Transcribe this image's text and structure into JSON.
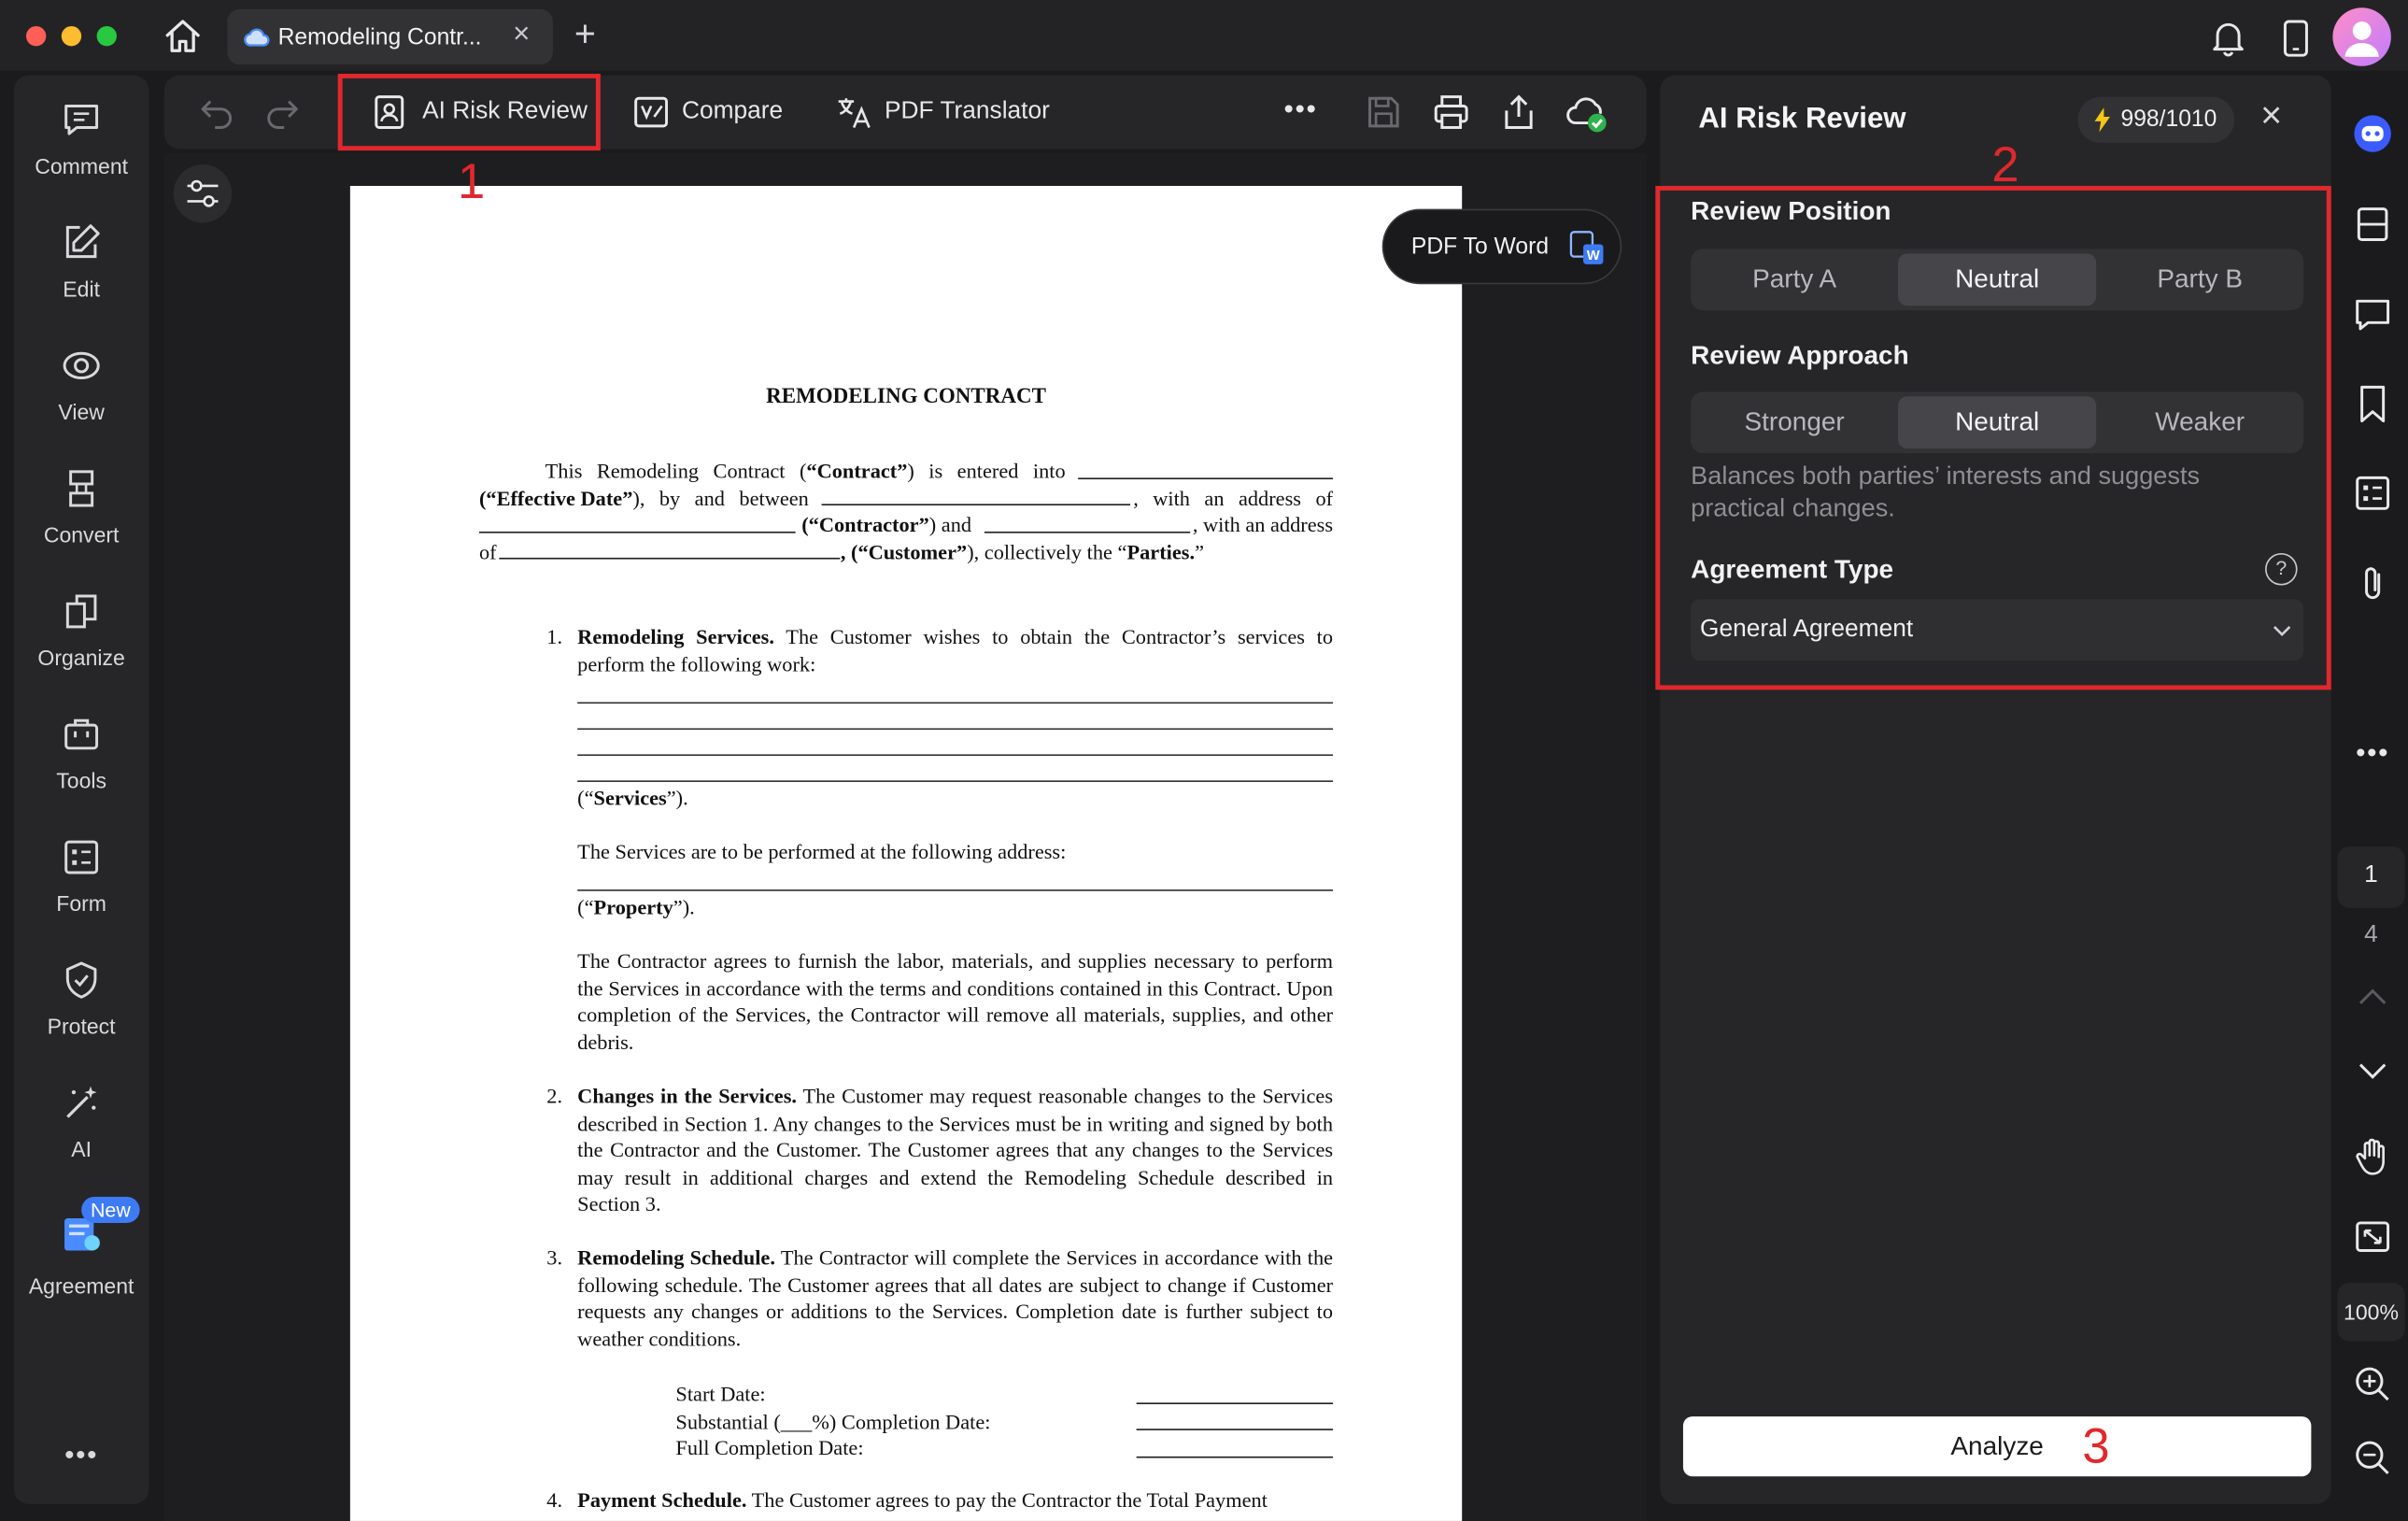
{
  "tab": {
    "title": "Remodeling Contr...",
    "close": "×",
    "new_tab": "+"
  },
  "sidebar": {
    "items": [
      {
        "label": "Comment",
        "icon": "comment-icon"
      },
      {
        "label": "Edit",
        "icon": "edit-icon"
      },
      {
        "label": "View",
        "icon": "view-icon"
      },
      {
        "label": "Convert",
        "icon": "convert-icon"
      },
      {
        "label": "Organize",
        "icon": "organize-icon"
      },
      {
        "label": "Tools",
        "icon": "tools-icon"
      },
      {
        "label": "Form",
        "icon": "form-icon"
      },
      {
        "label": "Protect",
        "icon": "shield-icon"
      },
      {
        "label": "AI",
        "icon": "magic-wand-icon"
      },
      {
        "label": "Agreement",
        "icon": "agreement-icon",
        "badge": "New"
      }
    ],
    "more": "•••"
  },
  "toolbar": {
    "ai_risk_review": "AI Risk Review",
    "compare": "Compare",
    "pdf_translator": "PDF Translator",
    "more": "•••"
  },
  "annotations": {
    "one": "1",
    "two": "2",
    "three": "3"
  },
  "pdf_to_word": "PDF To Word",
  "document": {
    "title": "REMODELING CONTRACT",
    "intro": {
      "l1a": "This Remodeling Contract (",
      "l1b": "“Contract”",
      "l1c": ") is entered into",
      "l2a": "(“Effective Date”",
      "l2b": "), by and between",
      "l2c": ", with an address of",
      "l3a": "(“Contractor”",
      "l3b": ") and",
      "l3c": ", with an address",
      "l4a": "of",
      "l4b": ", (“Customer”",
      "l4c": "), collectively the “",
      "l4d": "Parties.",
      "l4e": "”"
    },
    "s1": {
      "num": "1.",
      "heading": "Remodeling Services.",
      "text": " The Customer wishes to obtain the Contractor’s services to perform the following work:",
      "services_a": "(“",
      "services_b": "Services",
      "services_c": "”).",
      "address_text": "The Services are to be performed at the following address:",
      "property_a": "(“",
      "property_b": "Property",
      "property_c": "”).",
      "para": "The Contractor agrees to furnish the labor, materials, and supplies necessary to perform the Services in accordance with the terms and conditions contained in this Contract. Upon completion of the Services, the Contractor will remove all materials, supplies, and other debris."
    },
    "s2": {
      "num": "2.",
      "heading": "Changes in the Services.",
      "text": " The Customer may request reasonable changes to the Services described in Section 1. Any changes to the Services must be in writing and signed by both the Contractor and the Customer. The Customer agrees that any changes to the Services may result in additional charges and extend the Remodeling Schedule described in Section 3."
    },
    "s3": {
      "num": "3.",
      "heading": "Remodeling Schedule.",
      "text": " The Contractor will complete the Services in accordance with the following schedule. The Customer agrees that all dates are subject to change if Customer requests any changes or additions to the Services. Completion date is further subject to weather conditions.",
      "start": "Start Date:",
      "substantial": "Substantial (___%) Completion Date:",
      "full": "Full Completion Date:"
    },
    "s4": {
      "num": "4.",
      "heading": "Payment Schedule.",
      "text": " The Customer agrees to pay the Contractor the Total Payment"
    }
  },
  "panel": {
    "title": "AI Risk Review",
    "credits": "998/1010",
    "close": "×",
    "review_position": {
      "title": "Review Position",
      "options": [
        "Party A",
        "Neutral",
        "Party B"
      ],
      "selected": "Neutral"
    },
    "review_approach": {
      "title": "Review Approach",
      "options": [
        "Stronger",
        "Neutral",
        "Weaker"
      ],
      "selected": "Neutral",
      "description": "Balances both parties’ interests and suggests practical changes."
    },
    "agreement_type": {
      "title": "Agreement Type",
      "help": "?",
      "value": "General Agreement"
    },
    "analyze": "Analyze"
  },
  "rail": {
    "page_current": "1",
    "page_total": "4",
    "more": "•••",
    "zoom": "100%"
  },
  "colors": {
    "annotation_red": "#e0282e",
    "accent_blue": "#4a8cff",
    "credits_yellow": "#f5c518"
  }
}
